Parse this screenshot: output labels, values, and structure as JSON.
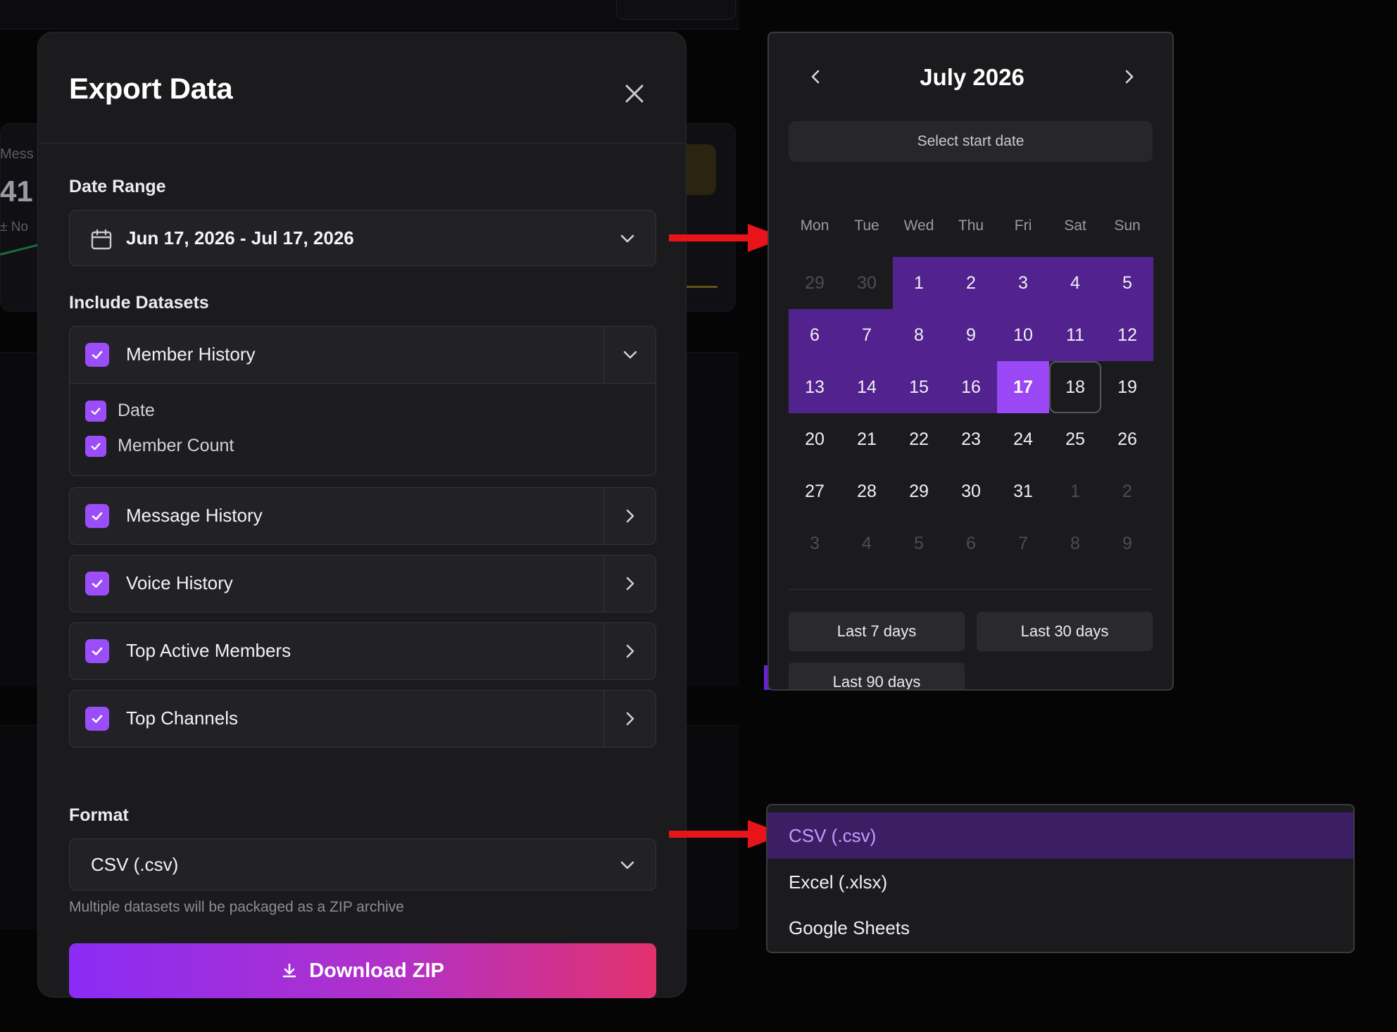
{
  "background": {
    "card_label": "Mess",
    "card_value": "41",
    "card_sub": "± No"
  },
  "modal": {
    "title": "Export Data",
    "close_icon": "close-icon",
    "date_range": {
      "label": "Date Range",
      "value": "Jun 17, 2026 - Jul 17, 2026",
      "icon": "calendar-icon"
    },
    "datasets": {
      "label": "Include Datasets",
      "items": [
        {
          "label": "Member History",
          "checked": true,
          "expanded": true,
          "fields": [
            {
              "label": "Date",
              "checked": true
            },
            {
              "label": "Member Count",
              "checked": true
            }
          ]
        },
        {
          "label": "Message History",
          "checked": true,
          "expanded": false
        },
        {
          "label": "Voice History",
          "checked": true,
          "expanded": false
        },
        {
          "label": "Top Active Members",
          "checked": true,
          "expanded": false
        },
        {
          "label": "Top Channels",
          "checked": true,
          "expanded": false
        }
      ]
    },
    "format": {
      "label": "Format",
      "value": "CSV (.csv)",
      "hint": "Multiple datasets will be packaged as a ZIP archive"
    },
    "download": {
      "label": "Download ZIP",
      "icon": "download-icon"
    }
  },
  "calendar": {
    "month": "July 2026",
    "hint": "Select start date",
    "weekdays": [
      "Mon",
      "Tue",
      "Wed",
      "Thu",
      "Fri",
      "Sat",
      "Sun"
    ],
    "weeks": [
      [
        "29",
        "30",
        "1",
        "2",
        "3",
        "4",
        "5"
      ],
      [
        "6",
        "7",
        "8",
        "9",
        "10",
        "11",
        "12"
      ],
      [
        "13",
        "14",
        "15",
        "16",
        "17",
        "18",
        "19"
      ],
      [
        "20",
        "21",
        "22",
        "23",
        "24",
        "25",
        "26"
      ],
      [
        "27",
        "28",
        "29",
        "30",
        "31",
        "1",
        "2"
      ],
      [
        "3",
        "4",
        "5",
        "6",
        "7",
        "8",
        "9"
      ]
    ],
    "range_end": "17",
    "hovered": "18",
    "presets": [
      "Last 7 days",
      "Last 30 days",
      "Last 90 days"
    ]
  },
  "format_dropdown": {
    "options": [
      "CSV (.csv)",
      "Excel (.xlsx)",
      "Google Sheets"
    ],
    "selected": "CSV (.csv)"
  },
  "colors": {
    "accent": "#9b4dfa",
    "range": "#52238f",
    "arrow": "#e8141a",
    "gradient_start": "#8a2cf5",
    "gradient_end": "#e2316e"
  }
}
